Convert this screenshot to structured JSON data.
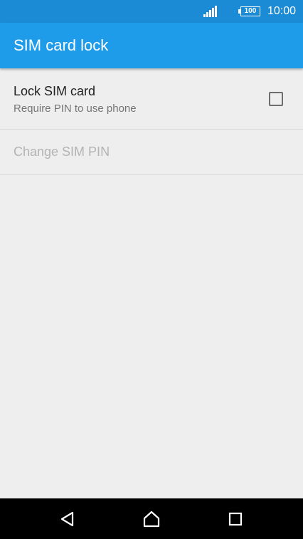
{
  "status_bar": {
    "battery_level": "100",
    "time": "10:00",
    "signal_icon": "signal-icon",
    "battery_icon": "battery-icon"
  },
  "app_bar": {
    "title": "SIM card lock"
  },
  "settings": {
    "lock_sim": {
      "title": "Lock SIM card",
      "summary": "Require PIN to use phone",
      "checked": false
    },
    "change_pin": {
      "title": "Change SIM PIN",
      "enabled": false
    }
  },
  "nav_bar": {
    "back_icon": "back-icon",
    "home_icon": "home-icon",
    "recents_icon": "recents-icon"
  },
  "colors": {
    "status_bar": "#1c8bd6",
    "app_bar": "#1e9cea",
    "background": "#eeeeee",
    "disabled_text": "#b3b3b3"
  }
}
